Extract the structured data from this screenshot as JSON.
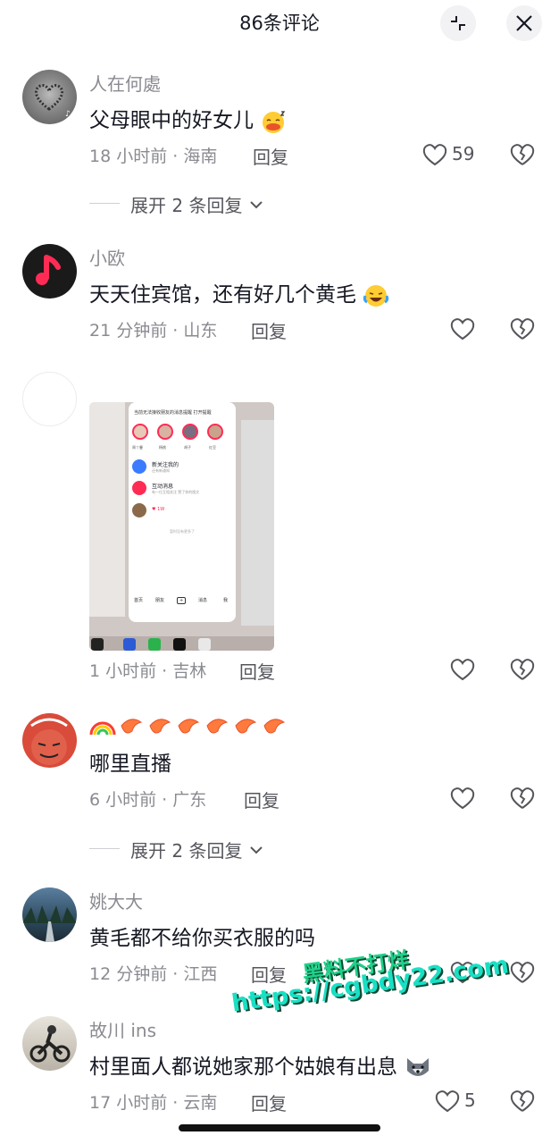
{
  "header": {
    "title": "86条评论",
    "collapse_icon": "collapse-icon",
    "close_icon": "close-icon"
  },
  "comments": [
    {
      "user": "人在何處",
      "text": "父母眼中的好女儿",
      "time": "18 小时前 · 海南",
      "reply": "回复",
      "likes": "59",
      "emoji": "sleepy-face"
    },
    {
      "user": "小欧",
      "text": "天天住宾馆，还有好几个黄毛",
      "time": "21 分钟前 · 山东",
      "reply": "回复",
      "likes": "",
      "emoji": "laughing-crying-face"
    },
    {
      "user": "",
      "text": "",
      "time": "1 小时前 · 吉林",
      "reply": "回复",
      "likes": ""
    },
    {
      "user": "",
      "text": "哪里直播",
      "time": "6 小时前 · 广东",
      "reply": "回复",
      "likes": "",
      "emoji": "rainbow-shrimp"
    },
    {
      "user": "姚大大",
      "text": "黄毛都不给你买衣服的吗",
      "time": "12 分钟前 · 江西",
      "reply": "回复",
      "likes": ""
    },
    {
      "user": "故川 ins",
      "text": "村里面人都说她家那个姑娘有出息",
      "time": "17 小时前 · 云南",
      "reply": "回复",
      "likes": "5",
      "emoji": "wolf-face"
    }
  ],
  "expand_replies": [
    "展开 2 条回复",
    "展开 2 条回复"
  ],
  "screenshot": {
    "banner": "当前无法接收朋友的消息提醒  打开提醒",
    "stories": [
      "周丫曼",
      "杨桃",
      "胡子",
      "红豆"
    ],
    "items": [
      "新关注我的",
      "互动消息"
    ],
    "item_subs": [
      "还有新通知",
      "有一位互相关注 赞了你的图文"
    ],
    "likes": "1W",
    "footer": "暂时没有更多了",
    "tabs": [
      "首页",
      "朋友",
      "+",
      "消息",
      "我"
    ]
  },
  "watermark": {
    "line1": "黑料不打烊",
    "line2": "https://cgbdy22.com"
  },
  "colors": {
    "text": "#161823",
    "muted": "#8a8b91",
    "accent": "#fe2c55"
  }
}
